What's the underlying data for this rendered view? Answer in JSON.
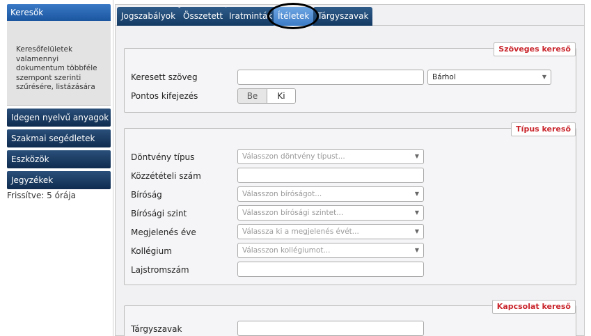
{
  "sidebar": {
    "header": "Keresők",
    "description": "Keresőfelületek valamennyi dokumentum többféle szempont szerinti szűrésére, listázására",
    "items": [
      "Idegen nyelvű anyagok",
      "Szakmai segédletek",
      "Eszközök",
      "Jegyzékek"
    ],
    "refresh": "Frissítve: 5 órája"
  },
  "tabs": [
    "Jogszabályok",
    "Összetett",
    "Iratminták",
    "Ítéletek",
    "Tárgyszavak"
  ],
  "active_tab": "Ítéletek",
  "text_search": {
    "legend": "Szöveges kereső",
    "searched_text_label": "Keresett szöveg",
    "searched_text_value": "",
    "scope_value": "Bárhol",
    "exact_label": "Pontos kifejezés",
    "exact_on": "Be",
    "exact_off": "Ki"
  },
  "type_search": {
    "legend": "Típus kereső",
    "fields": {
      "decision_type": {
        "label": "Döntvény típus",
        "placeholder": "Válasszon döntvény típust..."
      },
      "publication_number": {
        "label": "Közzétételi szám"
      },
      "court": {
        "label": "Bíróság",
        "placeholder": "Válasszon bíróságot..."
      },
      "court_level": {
        "label": "Bírósági szint",
        "placeholder": "Válasszon bírósági szintet..."
      },
      "year": {
        "label": "Megjelenés éve",
        "placeholder": "Válassza ki a megjelenés évét..."
      },
      "college": {
        "label": "Kollégium",
        "placeholder": "Válasszon kollégiumot..."
      },
      "registry": {
        "label": "Lajstromszám"
      }
    }
  },
  "relation_search": {
    "legend": "Kapcsolat kereső",
    "keywords_label": "Tárgyszavak"
  },
  "icons": {
    "caret": "chevron-down-icon"
  },
  "colors": {
    "tab": "#1f4670",
    "tab_active": "#4f8ed6",
    "legend_text": "#c9252c",
    "sidebar_head": "#2a67b1"
  }
}
